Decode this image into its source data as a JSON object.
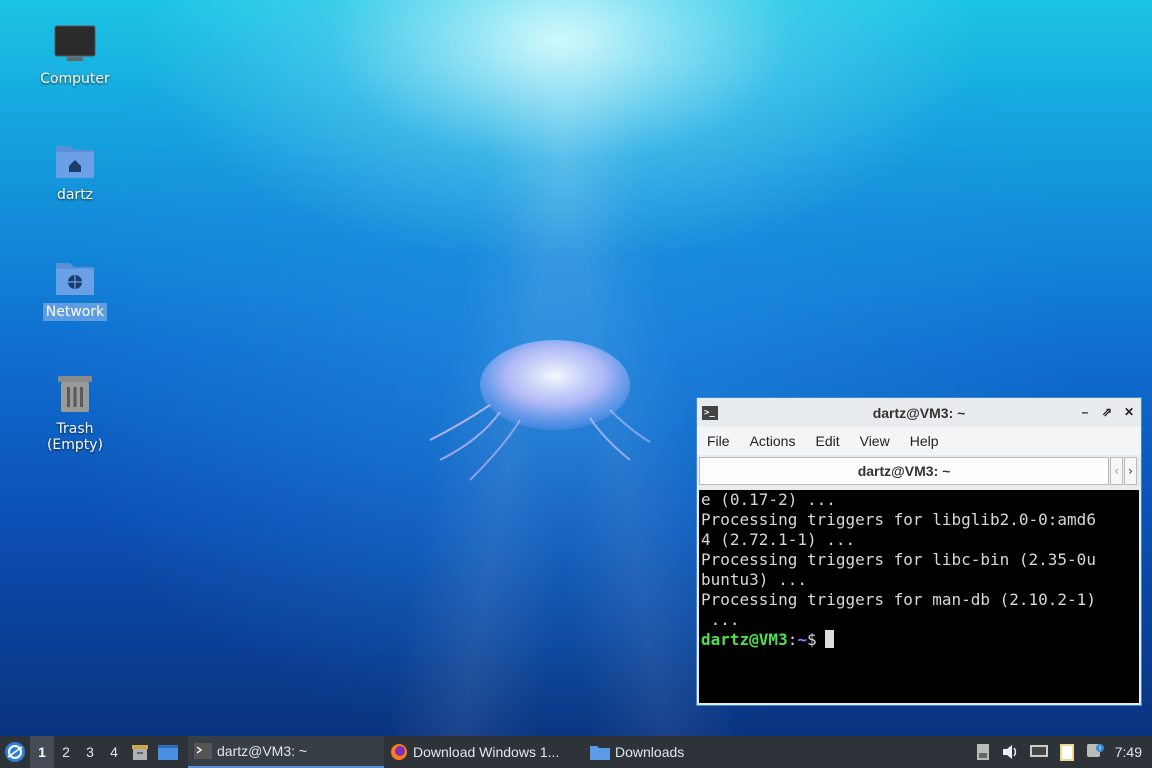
{
  "desktop": {
    "icons": [
      {
        "label": "Computer",
        "icon": "computer-icon"
      },
      {
        "label": "dartz",
        "icon": "home-folder-icon"
      },
      {
        "label": "Network",
        "icon": "network-folder-icon",
        "selected": true
      },
      {
        "label": "Trash (Empty)",
        "icon": "trash-icon"
      }
    ]
  },
  "terminal": {
    "title": "dartz@VM3: ~",
    "menu": [
      "File",
      "Actions",
      "Edit",
      "View",
      "Help"
    ],
    "tab_label": "dartz@VM3: ~",
    "lines": [
      "e (0.17-2) ...",
      "Processing triggers for libglib2.0-0:amd6",
      "4 (2.72.1-1) ...",
      "Processing triggers for libc-bin (2.35-0u",
      "buntu3) ...",
      "Processing triggers for man-db (2.10.2-1)",
      " ..."
    ],
    "prompt_user": "dartz@VM3",
    "prompt_sep": ":",
    "prompt_path": "~",
    "prompt_symbol": "$"
  },
  "taskbar": {
    "workspaces": [
      "1",
      "2",
      "3",
      "4"
    ],
    "active_workspace": "1",
    "tasks": [
      {
        "label": "dartz@VM3: ~",
        "icon": "terminal-icon",
        "active": true
      },
      {
        "label": "Download Windows 1...",
        "icon": "firefox-icon"
      },
      {
        "label": "Downloads",
        "icon": "folder-icon"
      }
    ],
    "tray_icons": [
      "keyboard-layout-icon",
      "volume-icon",
      "network-icon",
      "clipboard-icon",
      "notification-icon"
    ],
    "clock": "7:49"
  },
  "colors": {
    "accent": "#3b8ad8",
    "taskbar_bg": "#2e3339",
    "prompt_user": "#4ee04e",
    "prompt_path": "#6b8cff"
  }
}
